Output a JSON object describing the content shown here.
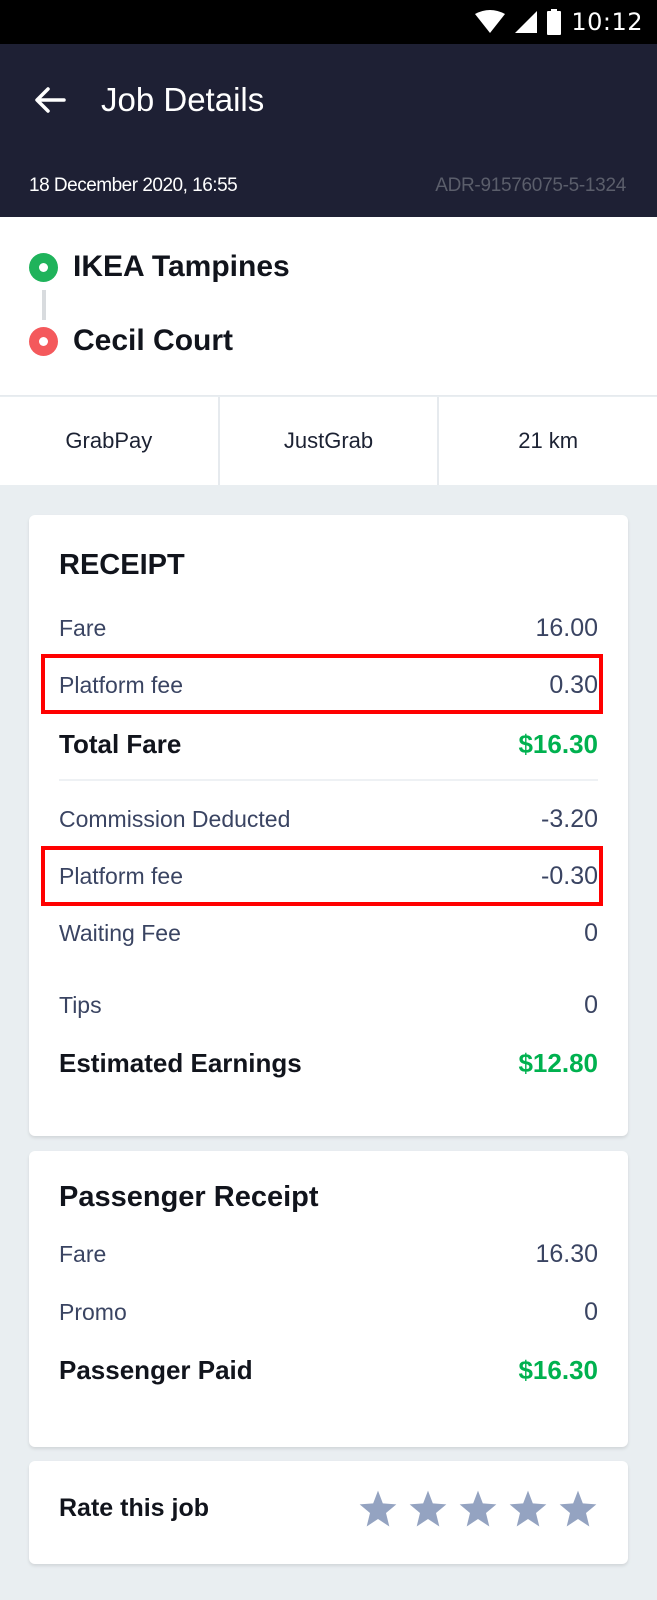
{
  "status_bar": {
    "time": "10:12",
    "icons": [
      "wifi-icon",
      "cellular-signal-icon",
      "battery-icon"
    ]
  },
  "header": {
    "back_icon": "arrow-left-icon",
    "title": "Job Details",
    "date": "18 December 2020, 16:55",
    "job_id": "ADR-91576075-5-1324"
  },
  "route": {
    "pickup": "IKEA Tampines",
    "dropoff": "Cecil Court",
    "colors": {
      "pickup": "#1fb35b",
      "dropoff": "#f4595c"
    }
  },
  "info": {
    "payment": "GrabPay",
    "service": "JustGrab",
    "distance": "21 km"
  },
  "receipt": {
    "title": "RECEIPT",
    "rows": [
      {
        "label": "Fare",
        "value": "16.00"
      },
      {
        "label": "Platform fee",
        "value": "0.30",
        "highlighted": true
      }
    ],
    "total": {
      "label": "Total Fare",
      "value": "$16.30"
    },
    "deductions": [
      {
        "label": "Commission Deducted",
        "value": "-3.20"
      },
      {
        "label": "Platform fee",
        "value": "-0.30",
        "highlighted": true
      },
      {
        "label": "Waiting Fee",
        "value": "0"
      },
      {
        "label": "Tips",
        "value": "0"
      }
    ],
    "earnings": {
      "label": "Estimated Earnings",
      "value": "$12.80"
    }
  },
  "passenger_receipt": {
    "title": "Passenger Receipt",
    "rows": [
      {
        "label": "Fare",
        "value": "16.30"
      },
      {
        "label": "Promo",
        "value": "0"
      }
    ],
    "total": {
      "label": "Passenger Paid",
      "value": "$16.30"
    }
  },
  "rating": {
    "label": "Rate this job",
    "max_stars": 5,
    "selected_stars": 0
  },
  "colors": {
    "header_bg": "#1e2034",
    "accent_green": "#00b14f",
    "highlight_red": "#ff0000",
    "star_color": "#94a3c1"
  }
}
